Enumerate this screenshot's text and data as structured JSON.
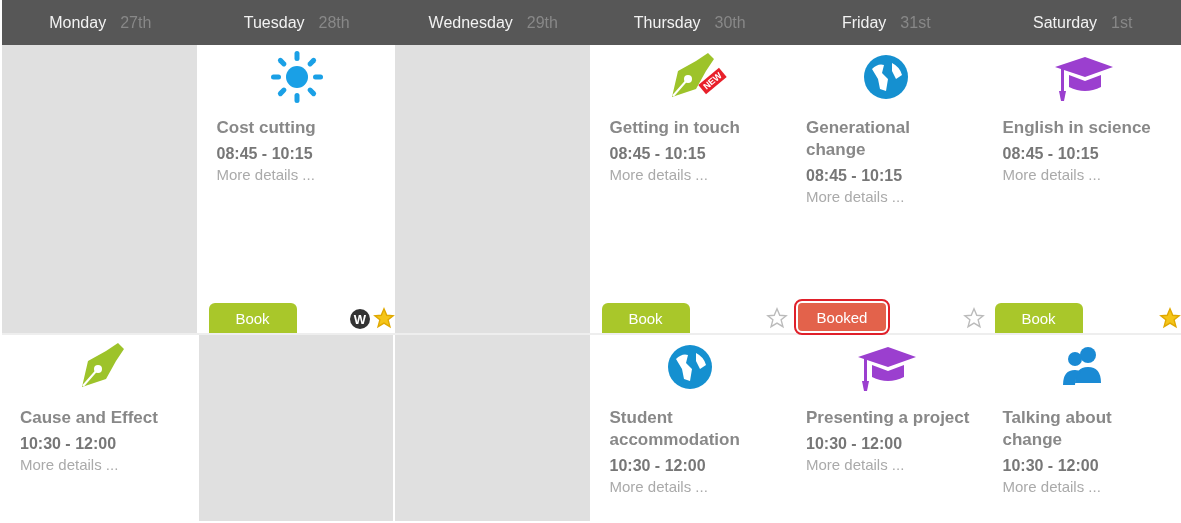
{
  "days": [
    {
      "name": "Monday",
      "date": "27th"
    },
    {
      "name": "Tuesday",
      "date": "28th"
    },
    {
      "name": "Wednesday",
      "date": "29th"
    },
    {
      "name": "Thursday",
      "date": "30th"
    },
    {
      "name": "Friday",
      "date": "31st"
    },
    {
      "name": "Saturday",
      "date": "1st"
    }
  ],
  "rows": [
    {
      "cells": [
        {
          "kind": "empty"
        },
        {
          "kind": "event",
          "icon": {
            "kind": "sun"
          },
          "title": "Cost cutting",
          "time": "08:45 - 10:15",
          "details": "More details ...",
          "booking": {
            "booked": false,
            "label": "Book",
            "highlighted": false
          },
          "tag": "W",
          "starred": true
        },
        {
          "kind": "empty"
        },
        {
          "kind": "event",
          "icon": {
            "kind": "pen"
          },
          "badge": "NEW",
          "title": "Getting in touch",
          "time": "08:45 - 10:15",
          "details": "More details ...",
          "booking": {
            "booked": false,
            "label": "Book",
            "highlighted": false
          },
          "starred": false
        },
        {
          "kind": "event",
          "icon": {
            "kind": "globe"
          },
          "title": "Generational change",
          "time": "08:45 - 10:15",
          "details": "More details ...",
          "booking": {
            "booked": true,
            "label": "Booked",
            "highlighted": true
          },
          "starred": false
        },
        {
          "kind": "event",
          "icon": {
            "kind": "cap"
          },
          "title": "English in science",
          "time": "08:45 - 10:15",
          "details": "More details ...",
          "booking": {
            "booked": false,
            "label": "Book",
            "highlighted": false
          },
          "starred": true
        }
      ]
    },
    {
      "cells": [
        {
          "kind": "event",
          "icon": {
            "kind": "pen"
          },
          "title": "Cause and Effect",
          "time": "10:30 - 12:00",
          "details": "More details ..."
        },
        {
          "kind": "empty"
        },
        {
          "kind": "empty"
        },
        {
          "kind": "event",
          "icon": {
            "kind": "globe"
          },
          "title": "Student accommodation",
          "time": "10:30 - 12:00",
          "details": "More details ..."
        },
        {
          "kind": "event",
          "icon": {
            "kind": "cap"
          },
          "title": "Presenting a project",
          "time": "10:30 - 12:00",
          "details": "More details ..."
        },
        {
          "kind": "event",
          "icon": {
            "kind": "people"
          },
          "title": "Talking about change",
          "time": "10:30 - 12:00",
          "details": "More details ..."
        }
      ]
    }
  ]
}
